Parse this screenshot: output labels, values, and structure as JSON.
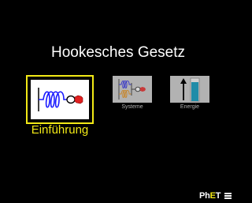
{
  "app": {
    "title": "Hookesches Gesetz"
  },
  "screens": [
    {
      "label": "Einführung",
      "icon": "spring-single-icon",
      "selected": true
    },
    {
      "label": "Systeme",
      "icon": "spring-systems-icon",
      "selected": false
    },
    {
      "label": "Energie",
      "icon": "energy-bar-icon",
      "selected": false
    }
  ],
  "navbar": {
    "logo": {
      "part1": "Ph",
      "part2": "E",
      "part3": "T"
    },
    "menu_icon": "hamburger-menu-icon"
  },
  "colors": {
    "background": "#000000",
    "title_text": "#ffffff",
    "selected_accent": "#f2e916",
    "unselected_text": "#b2b2b2",
    "spring_blue": "#1a1aff",
    "hand_red": "#e02020"
  }
}
